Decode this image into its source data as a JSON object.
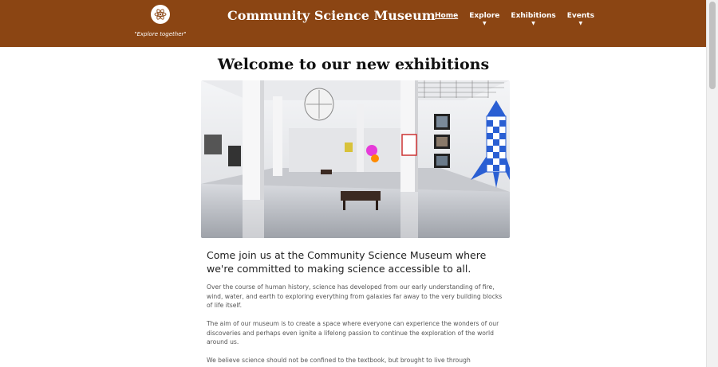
{
  "header": {
    "logo_icon": "atom-icon",
    "tagline": "\"Explore together\"",
    "site_title": "Community Science Museum",
    "nav": [
      {
        "label": "Home"
      },
      {
        "label": "Explore"
      },
      {
        "label": "Exhibitions"
      },
      {
        "label": "Events"
      }
    ],
    "color": "#8b4513"
  },
  "main": {
    "heading": "Welcome to our new exhibitions",
    "intro": "Come join us at the Community Science Museum where we're committed to making science accessible to all.",
    "paragraphs": [
      "Over the course of human history, science has developed from our early understanding of fire, wind, water, and earth to exploring everything from galaxies far away to the very building blocks of life itself.",
      "The aim of our museum is to create a space where everyone can experience the wonders of our discoveries and perhaps even ignite a lifelong passion to continue the exploration of the world around us.",
      "We believe science should not be confined to the textbook, but brought to live through"
    ]
  }
}
